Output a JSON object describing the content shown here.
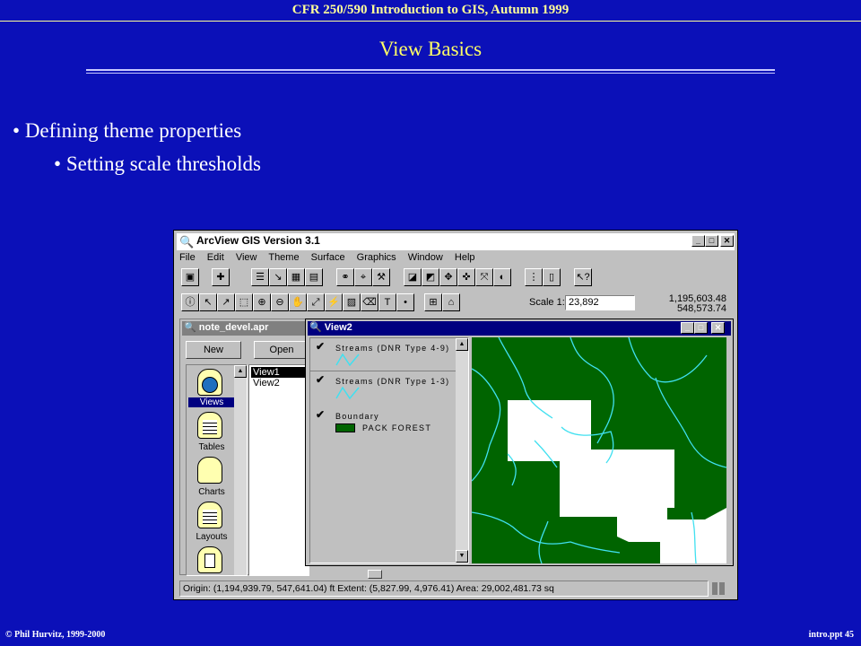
{
  "slide": {
    "header": "CFR 250/590 Introduction to GIS, Autumn 1999",
    "title": "View Basics",
    "bullet1": "Defining theme properties",
    "bullet2": "Setting scale thresholds",
    "footer_left": "© Phil Hurvitz, 1999-2000",
    "footer_right": "intro.ppt 45"
  },
  "app": {
    "title": "ArcView GIS Version 3.1",
    "menu": [
      "File",
      "Edit",
      "View",
      "Theme",
      "Surface",
      "Graphics",
      "Window",
      "Help"
    ],
    "scale_label": "Scale 1:",
    "scale_value": "23,892",
    "coord_x": "1,195,603.48",
    "coord_y": "548,573.74",
    "status": "Origin: (1,194,939.79, 547,641.04) ft  Extent: (5,827.99, 4,976.41)  Area: 29,002,481.73 sq"
  },
  "project": {
    "title": "note_devel.apr",
    "new_label": "New",
    "open_label": "Open",
    "doc_types": [
      "Views",
      "Tables",
      "Charts",
      "Layouts"
    ],
    "views": [
      "View1",
      "View2"
    ]
  },
  "view2": {
    "title": "View2",
    "themes": [
      {
        "name": "Streams (DNR Type 4-9)",
        "checked": true
      },
      {
        "name": "Streams (DNR Type 1-3)",
        "checked": true
      },
      {
        "name": "Boundary",
        "checked": true,
        "class_label": "PACK FOREST"
      }
    ]
  },
  "colors": {
    "slide_bg": "#0b10b8",
    "map_forest": "#006400",
    "streams": "#40e0f0"
  }
}
